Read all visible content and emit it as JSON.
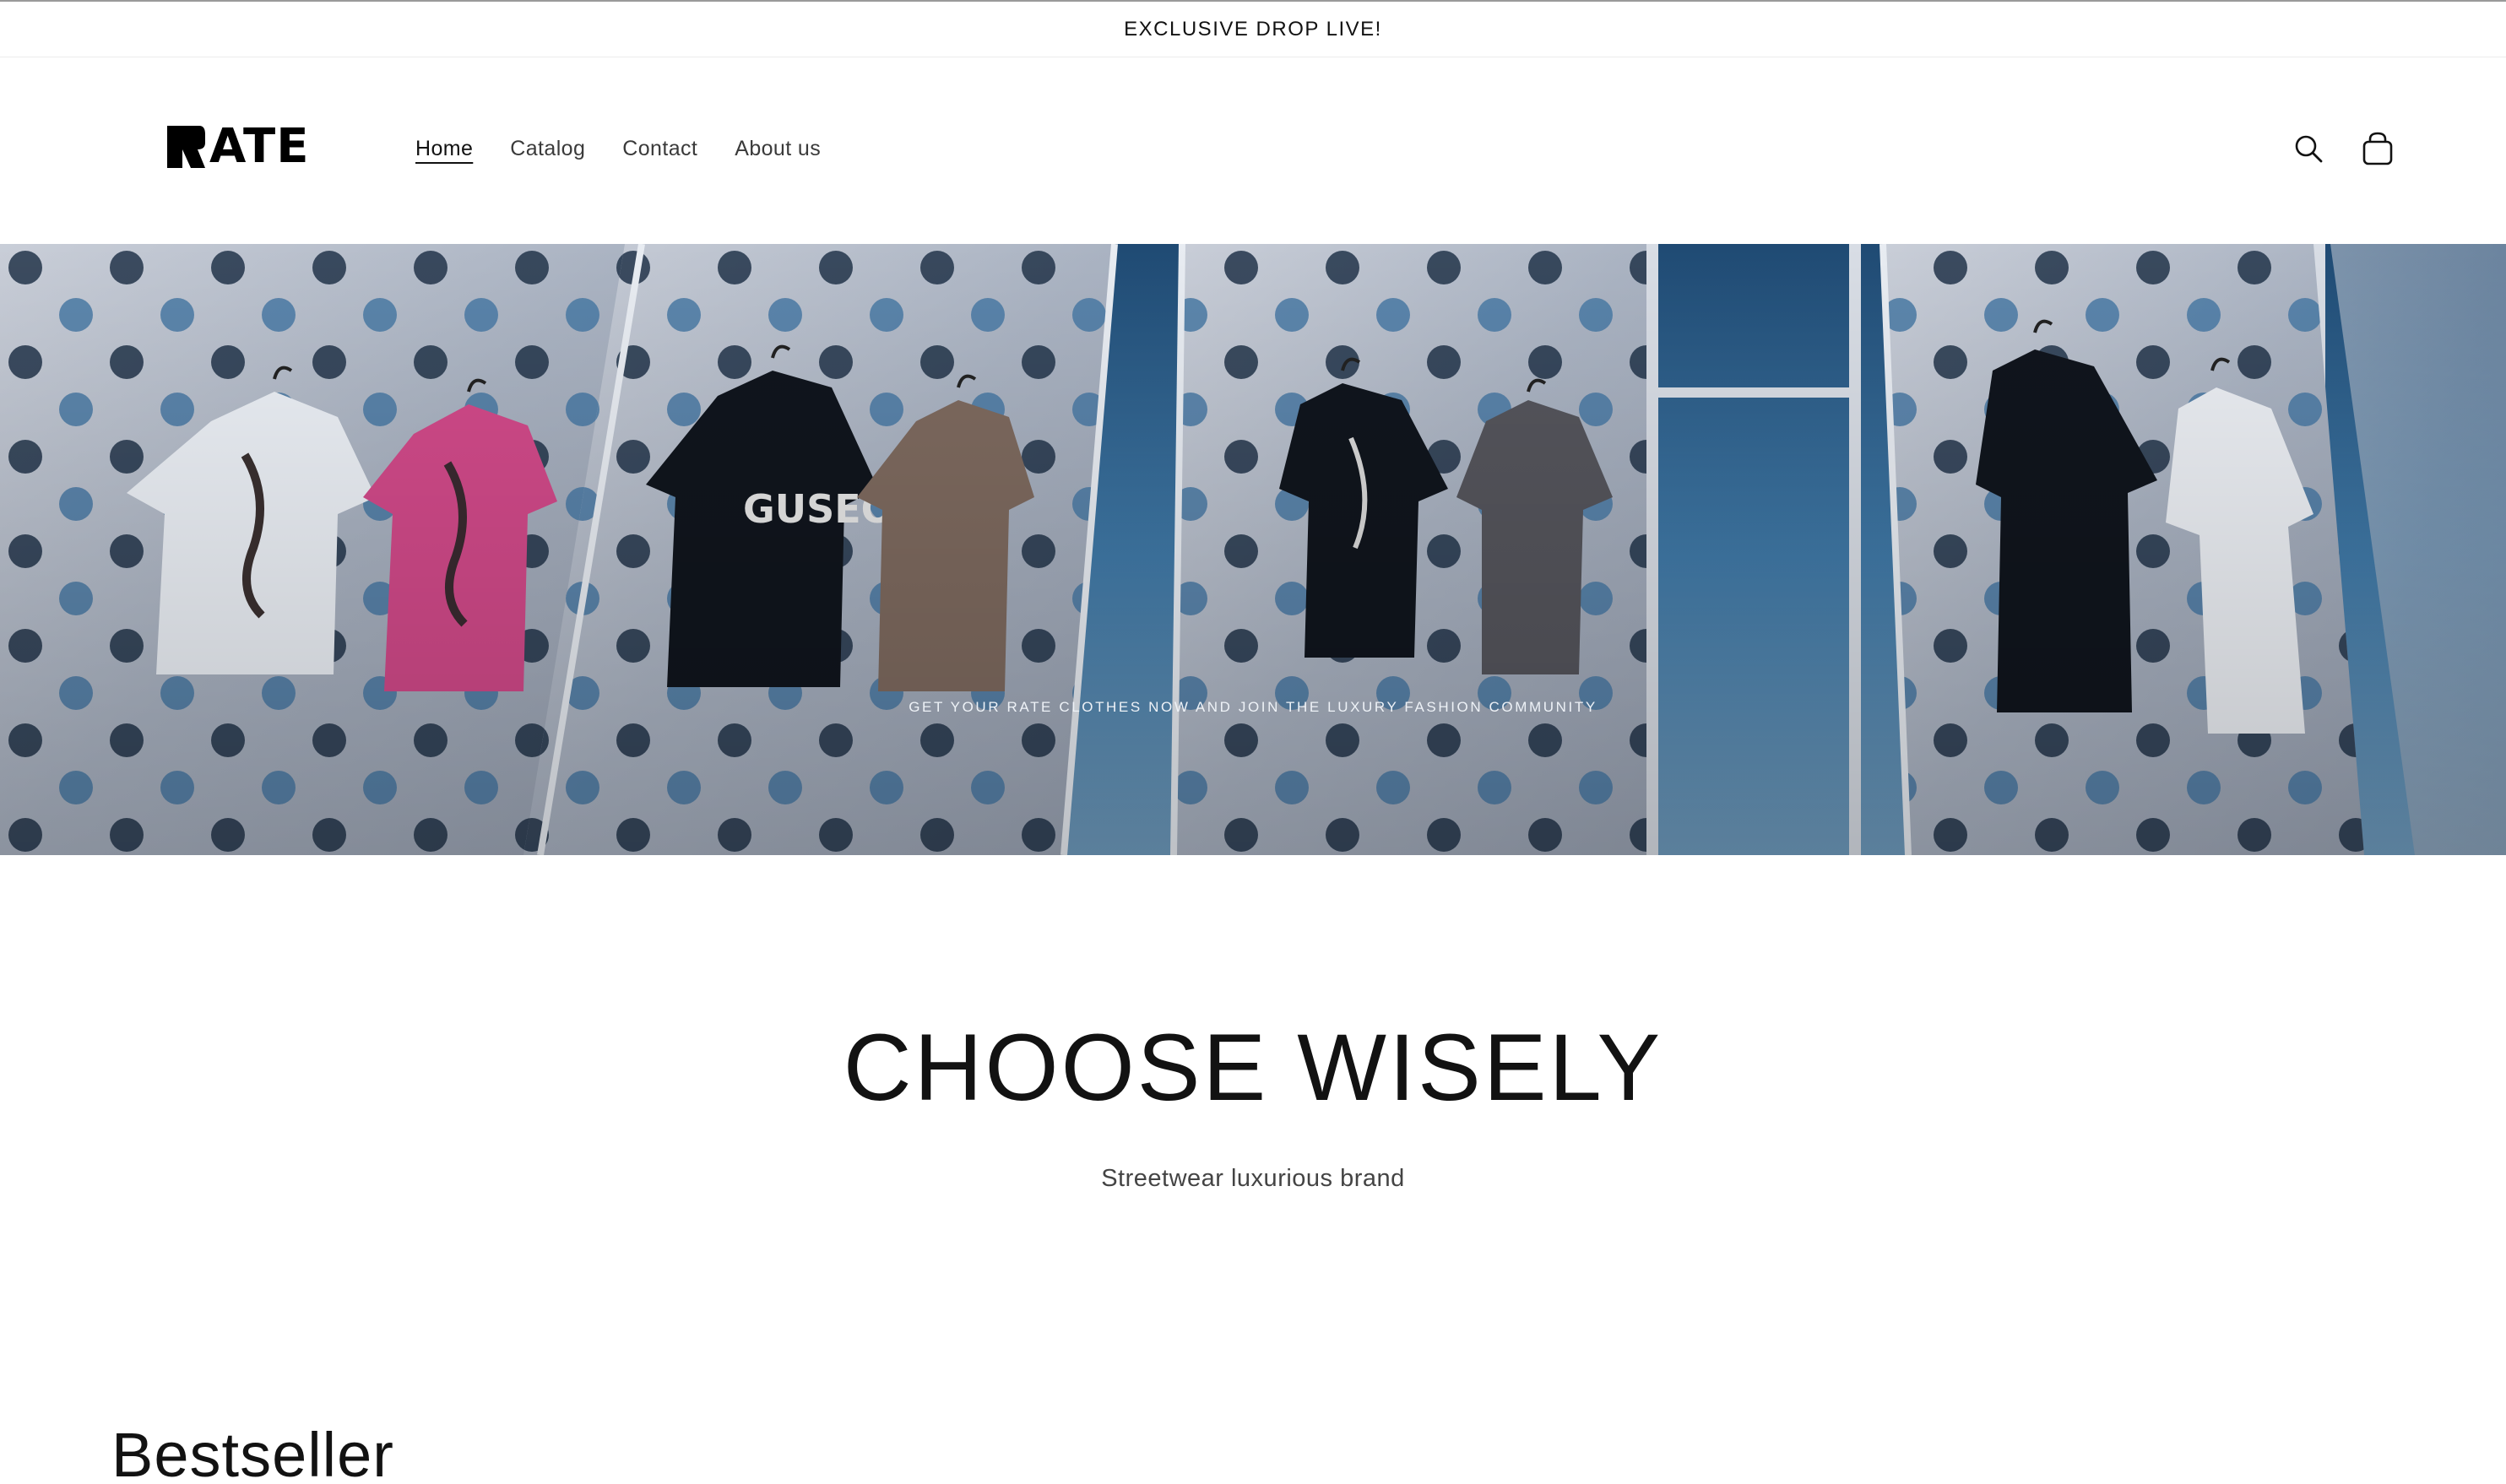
{
  "announcement": {
    "text": "EXCLUSIVE DROP LIVE!"
  },
  "header": {
    "logo_text": "ATE",
    "logo_icon": "rate-logo-mark",
    "nav": [
      {
        "label": "Home",
        "active": true
      },
      {
        "label": "Catalog",
        "active": false
      },
      {
        "label": "Contact",
        "active": false
      },
      {
        "label": "About us",
        "active": false
      }
    ],
    "icons": [
      "search-icon",
      "cart-icon"
    ]
  },
  "hero": {
    "caption": "GET YOUR RATE CLOTHES NOW AND JOIN THE LUXURY FASHION COMMUNITY"
  },
  "intro": {
    "heading": "CHOOSE WISELY",
    "subheading": "Streetwear luxurious brand"
  },
  "collection": {
    "title": "Bestseller"
  },
  "colors": {
    "text": "#121212",
    "wall": "#b7bfca",
    "glass": "#2f5f86",
    "shirt_white": "#eceff4",
    "shirt_pink": "#d24a8a",
    "shirt_black": "#10151d",
    "shirt_brown": "#7e6a5f",
    "shirt_gray": "#55555c"
  }
}
